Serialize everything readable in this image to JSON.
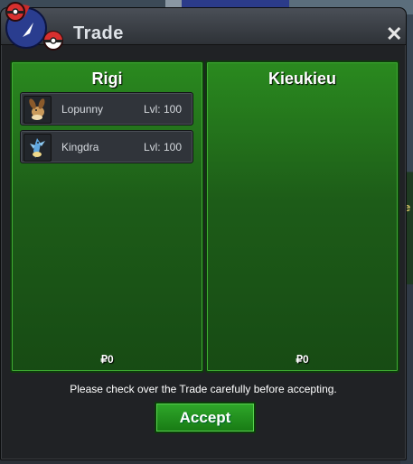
{
  "window": {
    "title": "Trade",
    "close_label": "✕"
  },
  "panels": [
    {
      "owner": "Rigi",
      "money": "₽0",
      "items": [
        {
          "name": "Lopunny",
          "level": "Lvl: 100",
          "icon": "lopunny-sprite-icon"
        },
        {
          "name": "Kingdra",
          "level": "Lvl: 100",
          "icon": "kingdra-sprite-icon"
        }
      ]
    },
    {
      "owner": "Kieukieu",
      "money": "₽0",
      "items": []
    }
  ],
  "notice": "Please check over the Trade carefully before accepting.",
  "accept_label": "Accept",
  "colors": {
    "panel_green": "#1d5c18",
    "accept_green": "#2fa82a"
  }
}
